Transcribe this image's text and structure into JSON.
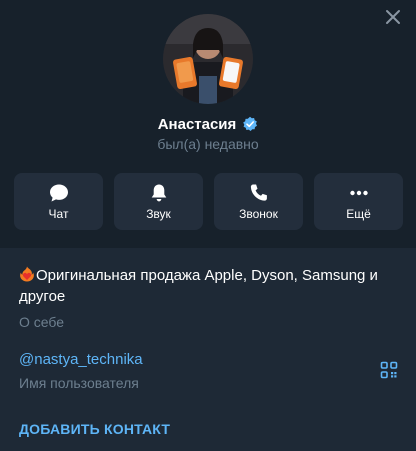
{
  "profile": {
    "name": "Анастасия",
    "status": "был(а) недавно",
    "verified": true
  },
  "actions": [
    {
      "label": "Чат",
      "icon": "chat-bubble-icon"
    },
    {
      "label": "Звук",
      "icon": "bell-icon"
    },
    {
      "label": "Звонок",
      "icon": "phone-icon"
    },
    {
      "label": "Ещё",
      "icon": "more-dots-icon"
    }
  ],
  "bio": {
    "text": "Оригинальная продажа Apple, Dyson, Samsung и другое",
    "label": "О себе",
    "emoji": "heart-on-fire-icon"
  },
  "username": {
    "value": "@nastya_technika",
    "label": "Имя пользователя"
  },
  "add_contact_label": "ДОБАВИТЬ КОНТАКТ",
  "colors": {
    "background": "#17212b",
    "info_background": "#1e2936",
    "button_background": "#232e3c",
    "accent": "#5eb5f7",
    "muted_text": "#6d7f8f"
  }
}
